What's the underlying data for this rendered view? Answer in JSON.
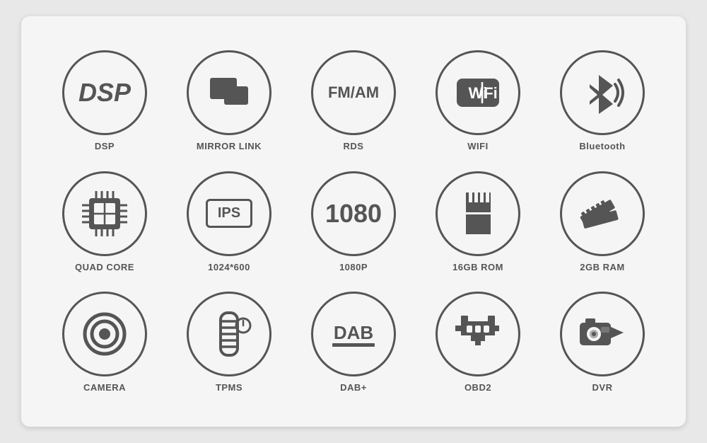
{
  "rows": [
    {
      "items": [
        {
          "id": "dsp",
          "label": "DSP"
        },
        {
          "id": "mirror-link",
          "label": "MIRROR LINK"
        },
        {
          "id": "rds",
          "label": "RDS"
        },
        {
          "id": "wifi",
          "label": "WIFI"
        },
        {
          "id": "bluetooth",
          "label": "Bluetooth"
        }
      ]
    },
    {
      "items": [
        {
          "id": "quad-core",
          "label": "QUAD CORE"
        },
        {
          "id": "1024-600",
          "label": "1024*600"
        },
        {
          "id": "1080p",
          "label": "1080P"
        },
        {
          "id": "16gb-rom",
          "label": "16GB ROM"
        },
        {
          "id": "2gb-ram",
          "label": "2GB RAM"
        }
      ]
    },
    {
      "items": [
        {
          "id": "camera",
          "label": "CAMERA"
        },
        {
          "id": "tpms",
          "label": "TPMS"
        },
        {
          "id": "dab",
          "label": "DAB+"
        },
        {
          "id": "obd2",
          "label": "OBD2"
        },
        {
          "id": "dvr",
          "label": "DVR"
        }
      ]
    }
  ]
}
